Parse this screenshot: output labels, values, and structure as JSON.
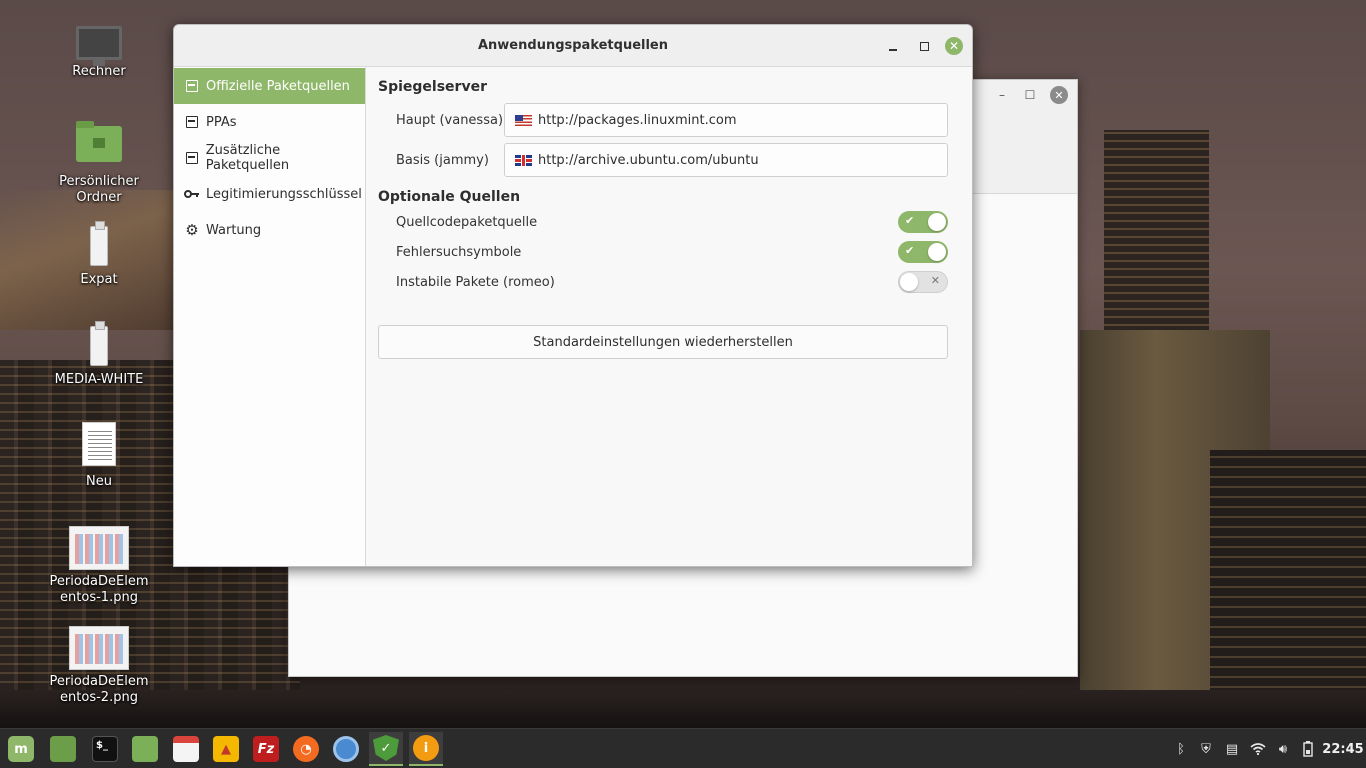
{
  "desktop": {
    "icons": [
      {
        "label": "Rechner",
        "icon": "computer-icon"
      },
      {
        "label": "Persönlicher Ordner",
        "icon": "home-folder-icon"
      },
      {
        "label": "Expat",
        "icon": "usb-drive-icon"
      },
      {
        "label": "MEDIA-WHITE",
        "icon": "usb-drive-icon"
      },
      {
        "label": "Neu",
        "icon": "document-icon"
      },
      {
        "label": "PeriodaDeElementos-1.png",
        "icon": "image-file-icon"
      },
      {
        "label": "PeriodaDeElementos-2.png",
        "icon": "image-file-icon"
      }
    ]
  },
  "window": {
    "title": "Anwendungspaketquellen",
    "sidebar": [
      {
        "label": "Offizielle Paketquellen",
        "icon": "package-icon",
        "active": true
      },
      {
        "label": "PPAs",
        "icon": "package-icon"
      },
      {
        "label": "Zusätzliche Paketquellen",
        "icon": "package-icon"
      },
      {
        "label": "Legitimierungsschlüssel",
        "icon": "key-icon"
      },
      {
        "label": "Wartung",
        "icon": "gear-icon"
      }
    ],
    "mirrors": {
      "title": "Spiegelserver",
      "main_label": "Haupt (vanessa)",
      "main_url": "http://packages.linuxmint.com",
      "main_flag": "us-flag-icon",
      "base_label": "Basis (jammy)",
      "base_url": "http://archive.ubuntu.com/ubuntu",
      "base_flag": "uk-flag-icon"
    },
    "optional": {
      "title": "Optionale Quellen",
      "items": [
        {
          "label": "Quellcodepaketquelle",
          "on": true
        },
        {
          "label": "Fehlersuchsymbole",
          "on": true
        },
        {
          "label": "Instabile Pakete (romeo)",
          "on": false
        }
      ]
    },
    "reset_label": "Standardeinstellungen wiederherstellen"
  },
  "taskbar": {
    "apps": [
      "mint-menu-icon",
      "files-icon",
      "terminal-icon",
      "folder-icon",
      "calendar-icon",
      "vlc-icon",
      "filezilla-icon",
      "firefox-icon",
      "chromium-icon",
      "update-manager-icon",
      "info-icon"
    ],
    "tray": [
      "bluetooth-icon",
      "shield-icon",
      "clipboard-icon",
      "wifi-icon",
      "volume-icon",
      "battery-icon"
    ],
    "clock": "22:45"
  },
  "colors": {
    "accent": "#8fb76a",
    "taskbar": "#2b2b2b"
  }
}
